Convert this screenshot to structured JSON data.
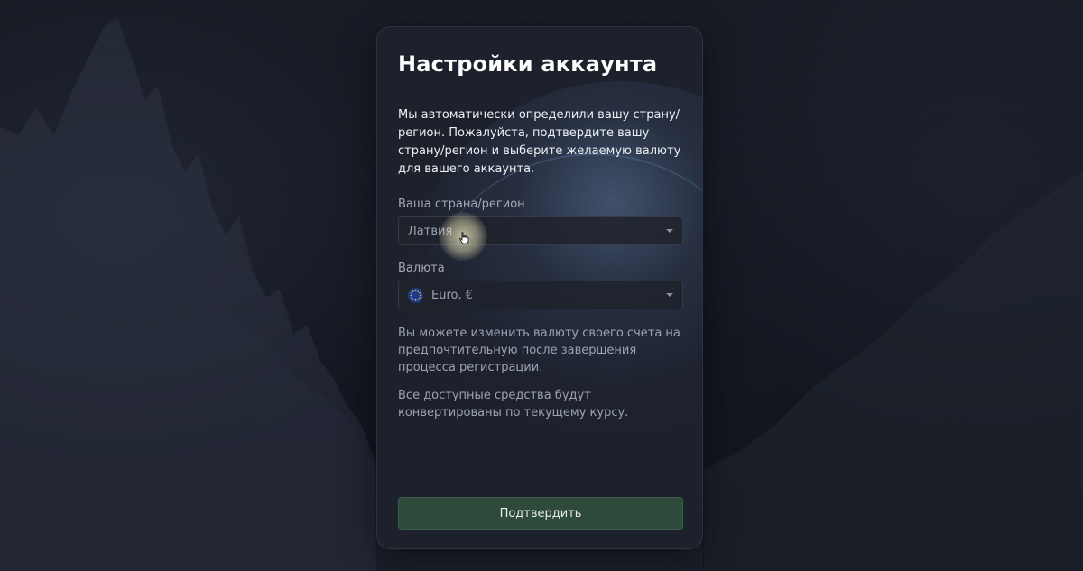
{
  "dialog": {
    "title": "Настройки аккаунта",
    "intro": "Мы автоматически определили вашу страну/регион. Пожалуйста, подтвердите вашу страну/регион и выберите желаемую валюту для вашего аккаунта."
  },
  "country_field": {
    "label": "Ваша страна/регион",
    "value": "Латвия"
  },
  "currency_field": {
    "label": "Валюта",
    "value": "Euro, €",
    "flag_icon": "eu-flag-icon"
  },
  "notes": {
    "change_currency": "Вы можете изменить валюту своего счета на предпочтительную после завершения процесса регистрации.",
    "conversion": "Все доступные средства будут конвертированы по текущему курсу."
  },
  "actions": {
    "confirm_label": "Подтвердить"
  },
  "colors": {
    "background": "#151820",
    "card": "#1d212c",
    "confirm_button": "#2e4a3b",
    "title_text": "#ffffff",
    "muted_text": "#9ca3b0"
  }
}
